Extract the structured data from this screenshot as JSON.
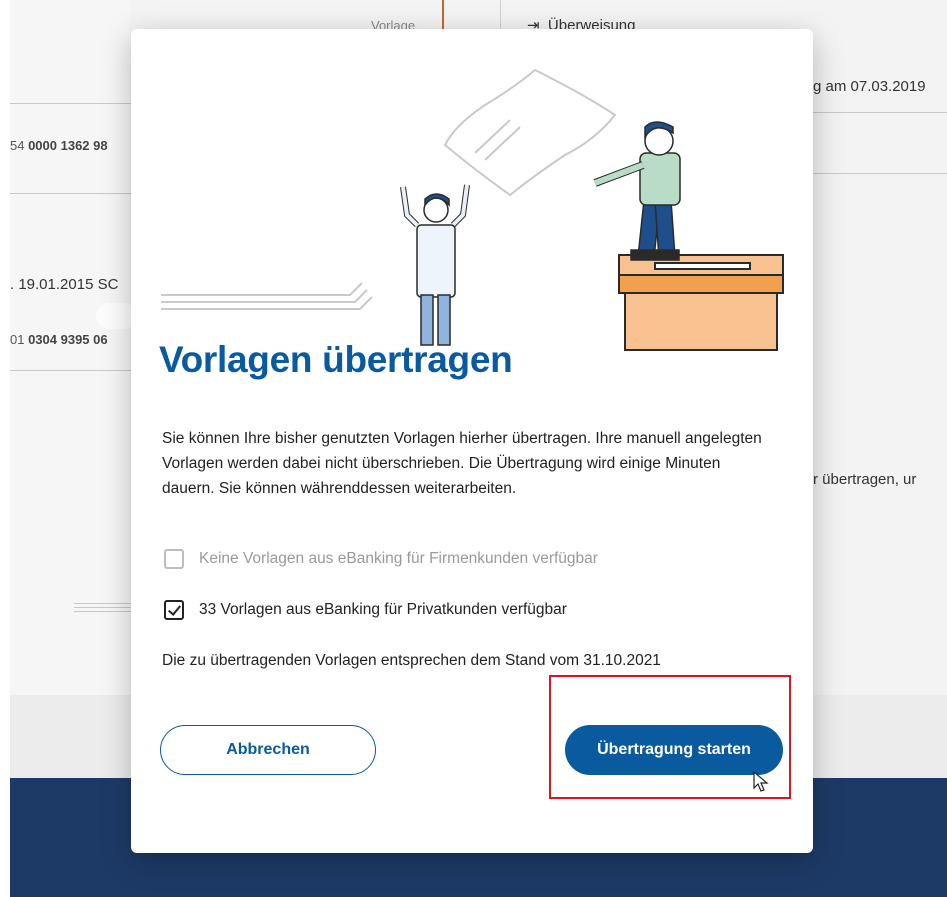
{
  "background": {
    "tab_label": "Vorlage",
    "transfer_link": "Überweisung",
    "date_text": "g am 07.03.2019",
    "iban_1_prefix": "54 ",
    "iban_1_bold": "0000 1362 98",
    "entry_date": ". 19.01.2015 SC",
    "iban_2_prefix": "01 ",
    "iban_2_bold": "0304 9395 06",
    "side_text": "r übertragen, ur"
  },
  "modal": {
    "title": "Vorlagen übertragen",
    "description": "Sie können Ihre bisher genutzten Vorlagen hierher übertragen. Ihre manuell angelegten Vorlagen werden dabei nicht überschrieben. Die Übertragung wird einige Minuten dauern. Sie können währenddessen weiterarbeiten.",
    "options": [
      {
        "label": "Keine Vorlagen aus eBanking für Firmenkunden verfügbar",
        "checked": false,
        "disabled": true
      },
      {
        "label": "33 Vorlagen aus eBanking für Privatkunden verfügbar",
        "checked": true,
        "disabled": false
      }
    ],
    "stand_text": "Die zu übertragenden Vorlagen entsprechen dem Stand vom 31.10.2021",
    "cancel_label": "Abbrechen",
    "start_label": "Übertragung starten"
  },
  "colors": {
    "primary": "#0a5aa0",
    "highlight": "#e0121b",
    "footer": "#1d3a66",
    "box": "#f7c28f"
  },
  "icons": [
    "transfer-icon",
    "checkbox-icon",
    "mouse-cursor-icon"
  ]
}
